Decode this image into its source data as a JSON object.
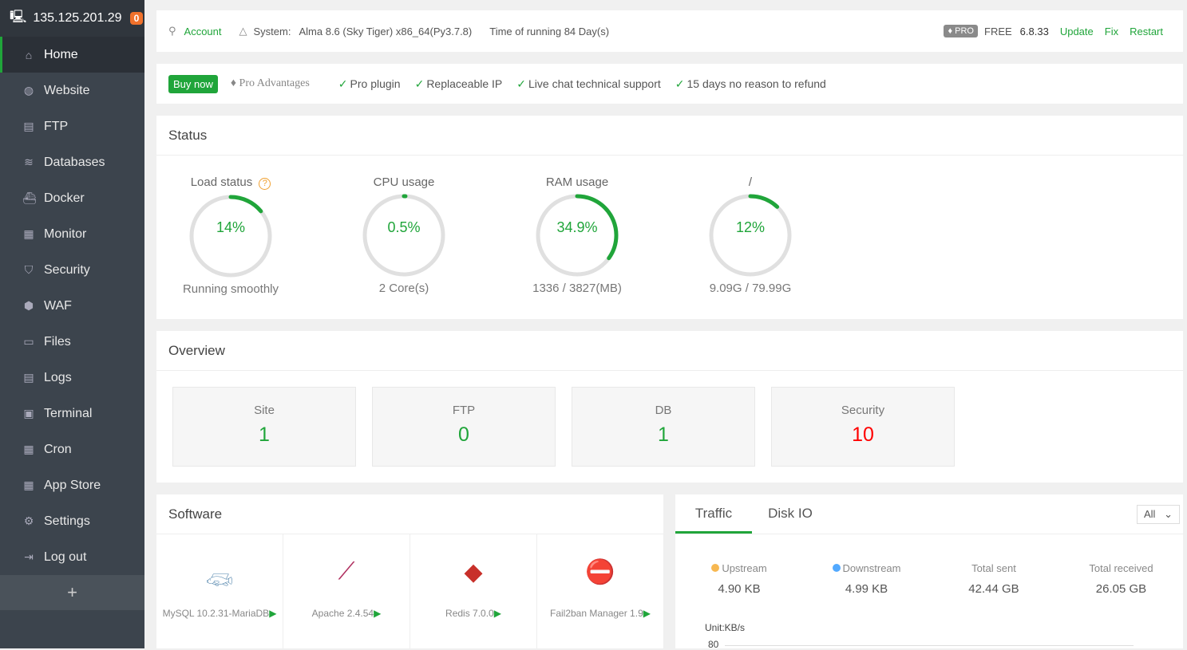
{
  "sidebar": {
    "ip": "135.125.201.29",
    "badge": "0",
    "items": [
      {
        "label": "Home",
        "icon": "home-icon"
      },
      {
        "label": "Website",
        "icon": "globe-icon"
      },
      {
        "label": "FTP",
        "icon": "ftp-icon"
      },
      {
        "label": "Databases",
        "icon": "database-icon"
      },
      {
        "label": "Docker",
        "icon": "docker-icon"
      },
      {
        "label": "Monitor",
        "icon": "monitor-icon"
      },
      {
        "label": "Security",
        "icon": "shield-icon"
      },
      {
        "label": "WAF",
        "icon": "waf-icon"
      },
      {
        "label": "Files",
        "icon": "folder-icon"
      },
      {
        "label": "Logs",
        "icon": "logs-icon"
      },
      {
        "label": "Terminal",
        "icon": "terminal-icon"
      },
      {
        "label": "Cron",
        "icon": "calendar-icon"
      },
      {
        "label": "App Store",
        "icon": "apps-icon"
      },
      {
        "label": "Settings",
        "icon": "gear-icon"
      },
      {
        "label": "Log out",
        "icon": "logout-icon"
      }
    ],
    "add": "+"
  },
  "topbar": {
    "account": "Account",
    "system_label": "System:",
    "system": "Alma 8.6 (Sky Tiger) x86_64(Py3.7.8)",
    "uptime": "Time of running 84 Day(s)",
    "pro": "PRO",
    "free": "FREE",
    "version": "6.8.33",
    "update": "Update",
    "fix": "Fix",
    "restart": "Restart"
  },
  "promo": {
    "buy": "Buy now",
    "advantages": "Pro Advantages",
    "features": [
      "Pro plugin",
      "Replaceable IP",
      "Live chat technical support",
      "15 days no reason to refund"
    ]
  },
  "status": {
    "title": "Status",
    "gauges": [
      {
        "label": "Load status",
        "value": "14%",
        "percent": 14,
        "sub": "Running smoothly"
      },
      {
        "label": "CPU usage",
        "value": "0.5%",
        "percent": 0.5,
        "sub": "2 Core(s)"
      },
      {
        "label": "RAM usage",
        "value": "34.9%",
        "percent": 34.9,
        "sub": "1336 / 3827(MB)"
      },
      {
        "label": "/",
        "value": "12%",
        "percent": 12,
        "sub": "9.09G / 79.99G"
      }
    ]
  },
  "overview": {
    "title": "Overview",
    "items": [
      {
        "label": "Site",
        "value": "1"
      },
      {
        "label": "FTP",
        "value": "0"
      },
      {
        "label": "DB",
        "value": "1"
      },
      {
        "label": "Security",
        "value": "10"
      }
    ]
  },
  "software": {
    "title": "Software",
    "items": [
      "MySQL 10.2.31-MariaDB",
      "Apache 2.4.54",
      "Redis 7.0.0",
      "Fail2ban Manager 1.9"
    ]
  },
  "traffic": {
    "tabs": [
      "Traffic",
      "Disk IO"
    ],
    "select": "All",
    "stats": [
      {
        "label": "Upstream",
        "value": "4.90 KB"
      },
      {
        "label": "Downstream",
        "value": "4.99 KB"
      },
      {
        "label": "Total sent",
        "value": "42.44 GB"
      },
      {
        "label": "Total received",
        "value": "26.05 GB"
      }
    ],
    "unit": "Unit:KB/s",
    "ytick": "80"
  },
  "colors": {
    "accent": "#20a53a",
    "danger": "#ff0000",
    "upstream": "#f7b851",
    "downstream": "#52a9ff"
  }
}
